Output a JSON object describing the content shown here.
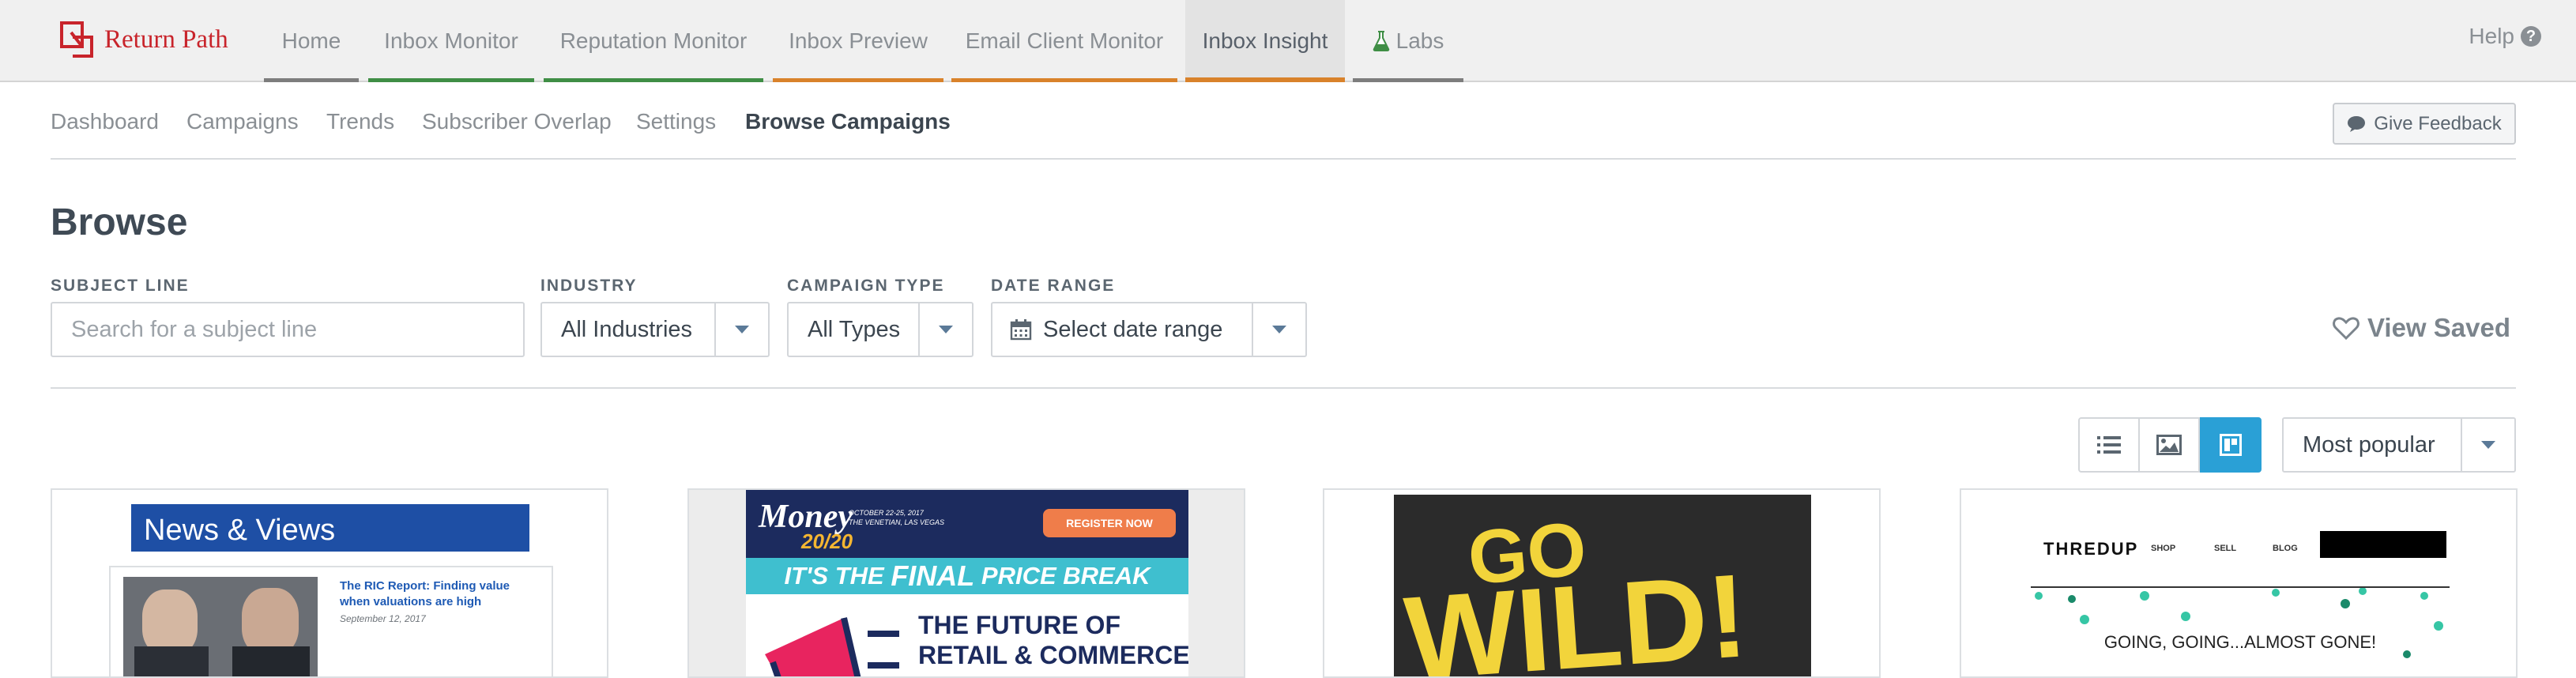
{
  "brand": {
    "name": "Return Path",
    "color": "#c8242b"
  },
  "topnav": {
    "tabs": [
      {
        "label": "Home",
        "color": "#7d7d7d"
      },
      {
        "label": "Inbox Monitor",
        "color": "#3f8e45"
      },
      {
        "label": "Reputation Monitor",
        "color": "#3f8e45"
      },
      {
        "label": "Inbox Preview",
        "color": "#d9822b"
      },
      {
        "label": "Email Client Monitor",
        "color": "#d9822b"
      },
      {
        "label": "Inbox Insight",
        "color": "#d9822b",
        "active": true
      },
      {
        "label": "Labs",
        "color": "#7d7d7d",
        "icon": "flask-icon"
      }
    ],
    "help_label": "Help"
  },
  "subnav": {
    "items": [
      "Dashboard",
      "Campaigns",
      "Trends",
      "Subscriber Overlap",
      "Settings",
      "Browse Campaigns"
    ],
    "current": "Browse Campaigns",
    "feedback_label": "Give Feedback"
  },
  "page": {
    "title": "Browse"
  },
  "filters": {
    "subject_line": {
      "label": "SUBJECT LINE",
      "placeholder": "Search for a subject line",
      "value": ""
    },
    "industry": {
      "label": "INDUSTRY",
      "value": "All Industries"
    },
    "campaign_type": {
      "label": "CAMPAIGN TYPE",
      "value": "All Types"
    },
    "date_range": {
      "label": "DATE RANGE",
      "value": "Select date range"
    },
    "view_saved_label": "View Saved"
  },
  "view": {
    "modes": [
      "list-view",
      "image-view",
      "grid-view"
    ],
    "active_mode": "grid-view",
    "sort": "Most popular",
    "accent": "#2aa0d6"
  },
  "cards": [
    {
      "header": "News & Views",
      "headline": "The RIC Report: Finding value when valuations are high",
      "date": "September 12, 2017"
    },
    {
      "brand_big": "Money",
      "brand_small": "20/20",
      "event_line1": "OCTOBER 22-25, 2017",
      "event_line2": "THE VENETIAN, LAS VEGAS",
      "cta": "REGISTER NOW",
      "banner_pre": "IT'S THE ",
      "banner_em": "FINAL",
      "banner_post": " PRICE BREAK",
      "tagline_1": "THE FUTURE OF",
      "tagline_2": "RETAIL & COMMERCE"
    },
    {
      "line1": "GO",
      "line2": "WILD!"
    },
    {
      "logo": "THREDUP",
      "nav": [
        "SHOP",
        "SELL",
        "BLOG"
      ],
      "message": "GOING, GOING...ALMOST GONE!"
    }
  ]
}
